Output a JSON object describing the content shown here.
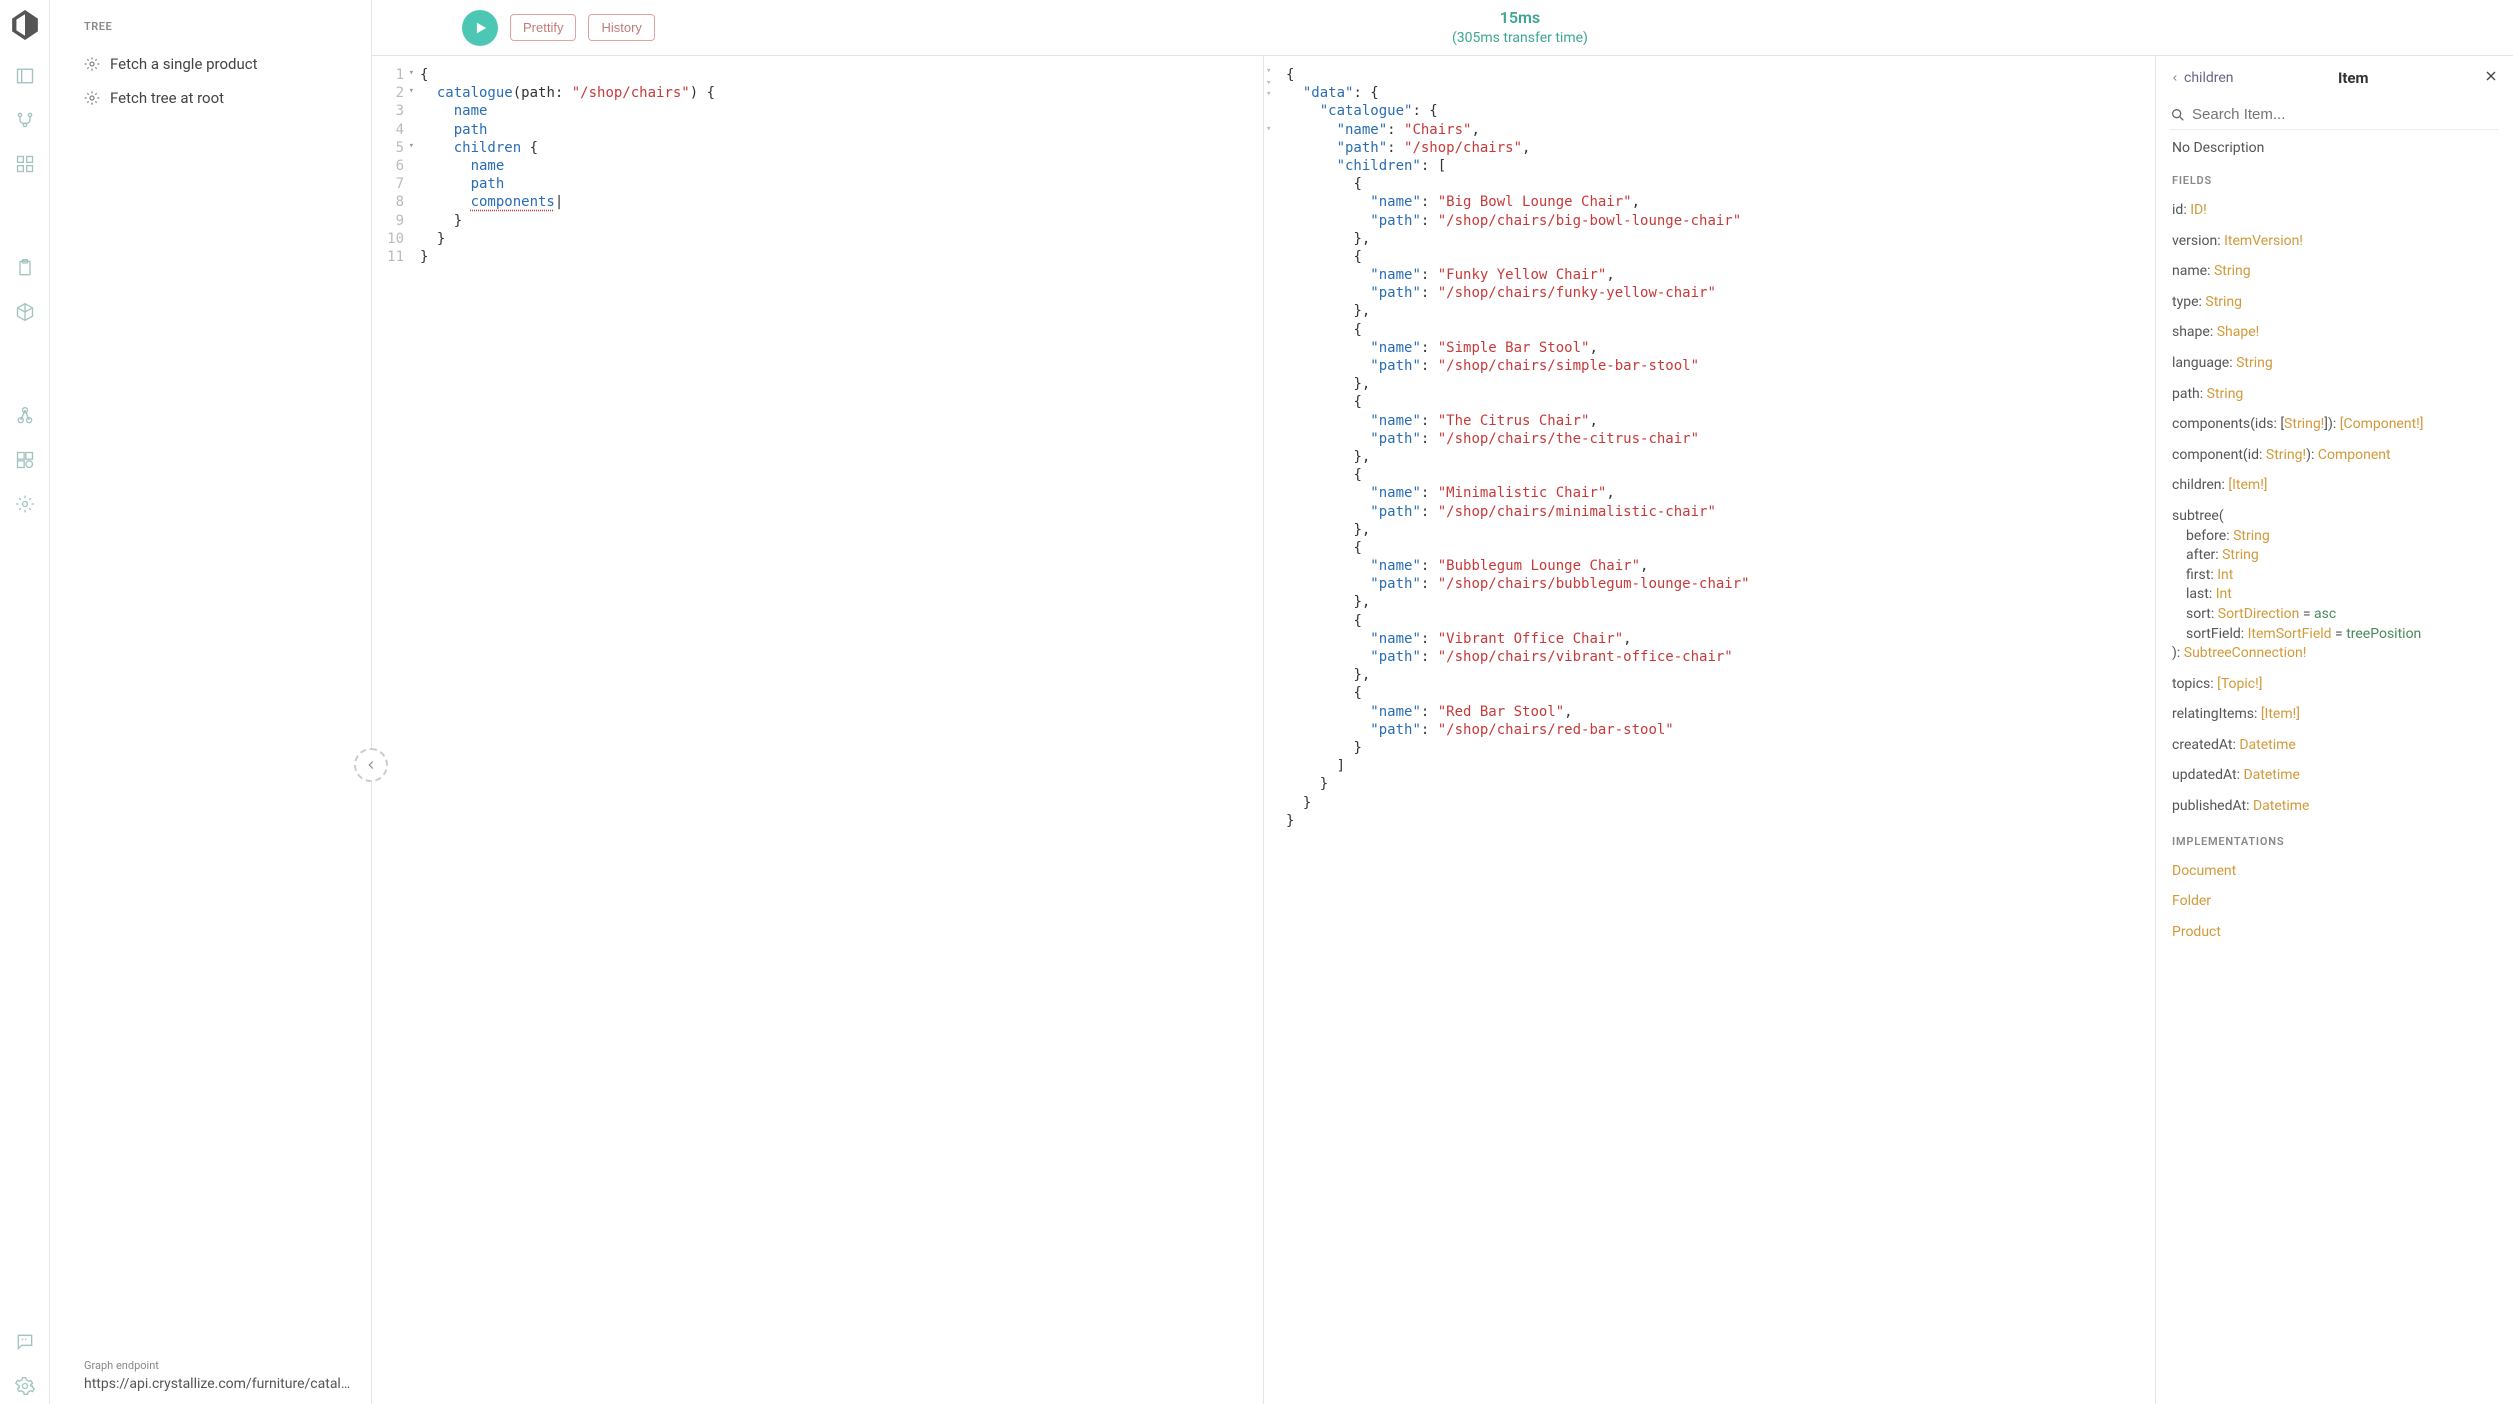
{
  "sidebar": {
    "heading": "TREE",
    "items": [
      {
        "label": "Fetch a single product"
      },
      {
        "label": "Fetch tree at root"
      }
    ],
    "endpoint_label": "Graph endpoint",
    "endpoint_value": "https://api.crystallize.com/furniture/catalogue"
  },
  "toolbar": {
    "prettify": "Prettify",
    "history": "History",
    "timing_main": "15ms",
    "timing_sub": "(305ms transfer time)"
  },
  "query": {
    "lines": [
      "1",
      "2",
      "3",
      "4",
      "5",
      "6",
      "7",
      "8",
      "9",
      "10",
      "11"
    ],
    "path_literal": "\"/shop/chairs\"",
    "fields": {
      "catalogue": "catalogue",
      "path_arg": "path",
      "name": "name",
      "path": "path",
      "children": "children",
      "components": "components"
    }
  },
  "result": {
    "root": {
      "data": {
        "catalogue": {
          "name": "Chairs",
          "path": "/shop/chairs",
          "children": [
            {
              "name": "Big Bowl Lounge Chair",
              "path": "/shop/chairs/big-bowl-lounge-chair"
            },
            {
              "name": "Funky Yellow Chair",
              "path": "/shop/chairs/funky-yellow-chair"
            },
            {
              "name": "Simple Bar Stool",
              "path": "/shop/chairs/simple-bar-stool"
            },
            {
              "name": "The Citrus Chair",
              "path": "/shop/chairs/the-citrus-chair"
            },
            {
              "name": "Minimalistic Chair",
              "path": "/shop/chairs/minimalistic-chair"
            },
            {
              "name": "Bubblegum Lounge Chair",
              "path": "/shop/chairs/bubblegum-lounge-chair"
            },
            {
              "name": "Vibrant Office Chair",
              "path": "/shop/chairs/vibrant-office-chair"
            },
            {
              "name": "Red Bar Stool",
              "path": "/shop/chairs/red-bar-stool"
            }
          ]
        }
      }
    }
  },
  "docs": {
    "back_label": "children",
    "title": "Item",
    "search_placeholder": "Search Item...",
    "no_desc": "No Description",
    "fields_heading": "FIELDS",
    "fields": [
      {
        "name": "id",
        "type": "ID!"
      },
      {
        "name": "version",
        "type": "ItemVersion!"
      },
      {
        "name": "name",
        "type": "String"
      },
      {
        "name": "type",
        "type": "String"
      },
      {
        "name": "shape",
        "type": "Shape!"
      },
      {
        "name": "language",
        "type": "String"
      },
      {
        "name": "path",
        "type": "String"
      },
      {
        "name": "components",
        "args": "(ids: [String!])",
        "type": "[Component!]"
      },
      {
        "name": "component",
        "args": "(id: String!)",
        "type": "Component"
      },
      {
        "name": "children",
        "type": "[Item!]"
      }
    ],
    "subtree": {
      "name": "subtree",
      "params": [
        {
          "name": "before",
          "type": "String"
        },
        {
          "name": "after",
          "type": "String"
        },
        {
          "name": "first",
          "type": "Int"
        },
        {
          "name": "last",
          "type": "Int"
        },
        {
          "name": "sort",
          "type": "SortDirection",
          "def": "asc"
        },
        {
          "name": "sortField",
          "type": "ItemSortField",
          "def": "treePosition"
        }
      ],
      "ret": "SubtreeConnection!"
    },
    "fields_tail": [
      {
        "name": "topics",
        "type": "[Topic!]"
      },
      {
        "name": "relatingItems",
        "type": "[Item!]"
      },
      {
        "name": "createdAt",
        "type": "Datetime"
      },
      {
        "name": "updatedAt",
        "type": "Datetime"
      },
      {
        "name": "publishedAt",
        "type": "Datetime"
      }
    ],
    "implementations_heading": "IMPLEMENTATIONS",
    "implementations": [
      "Document",
      "Folder",
      "Product"
    ]
  }
}
